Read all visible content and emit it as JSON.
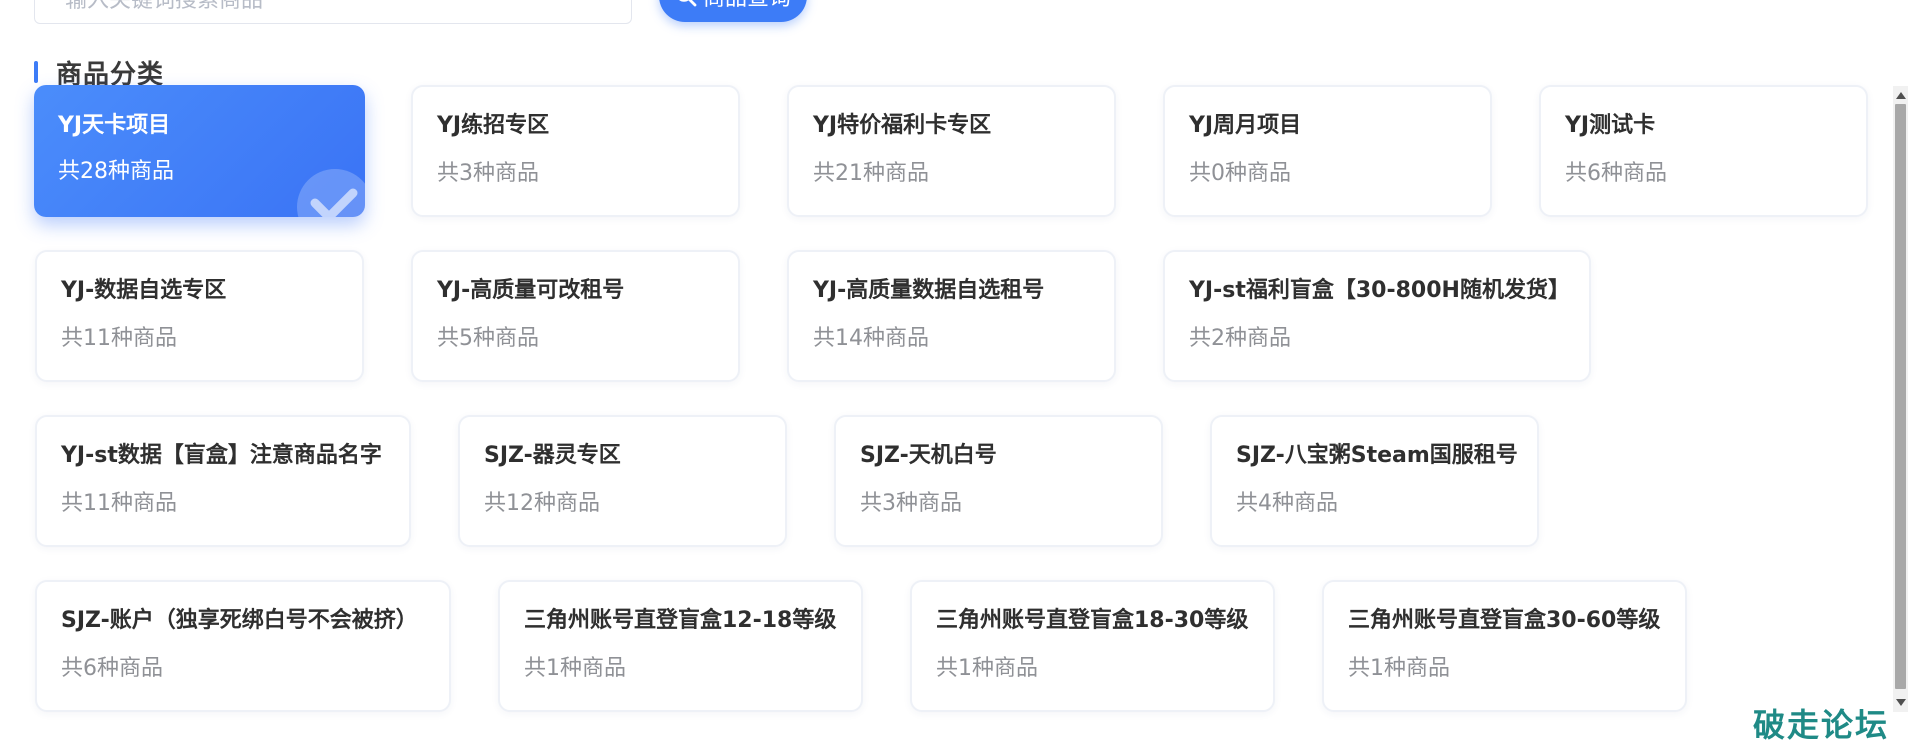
{
  "search": {
    "placeholder": "输入关键词搜索商品",
    "button_label": "商品查询"
  },
  "section": {
    "title": "商品分类"
  },
  "categories": [
    {
      "name": "YJ天卡项目",
      "count": "共28种商品",
      "active": true
    },
    {
      "name": "YJ练招专区",
      "count": "共3种商品"
    },
    {
      "name": "YJ特价福利卡专区",
      "count": "共21种商品"
    },
    {
      "name": "YJ周月项目",
      "count": "共0种商品"
    },
    {
      "name": "YJ测试卡",
      "count": "共6种商品"
    },
    {
      "name": "YJ-数据自选专区",
      "count": "共11种商品"
    },
    {
      "name": "YJ-高质量可改租号",
      "count": "共5种商品"
    },
    {
      "name": "YJ-高质量数据自选租号",
      "count": "共14种商品"
    },
    {
      "name": "YJ-st福利盲盒【30-800H随机发货】",
      "count": "共2种商品"
    },
    {
      "name": "YJ-st数据【盲盒】注意商品名字",
      "count": "共11种商品"
    },
    {
      "name": "SJZ-器灵专区",
      "count": "共12种商品"
    },
    {
      "name": "SJZ-天机白号",
      "count": "共3种商品"
    },
    {
      "name": "SJZ-八宝粥Steam国服租号",
      "count": "共4种商品"
    },
    {
      "name": "SJZ-账户（独享死绑白号不会被挤）",
      "count": "共6种商品"
    },
    {
      "name": "三角州账号直登盲盒12-18等级",
      "count": "共1种商品"
    },
    {
      "name": "三角州账号直登盲盒18-30等级",
      "count": "共1种商品"
    },
    {
      "name": "三角州账号直登盲盒30-60等级",
      "count": "共1种商品"
    }
  ],
  "icons": {
    "search": "search-icon",
    "selected": "check-icon"
  },
  "colors": {
    "accent": "#3d7cf7",
    "watermark": "#1f8a86"
  },
  "watermark": {
    "text": "破走论坛"
  }
}
